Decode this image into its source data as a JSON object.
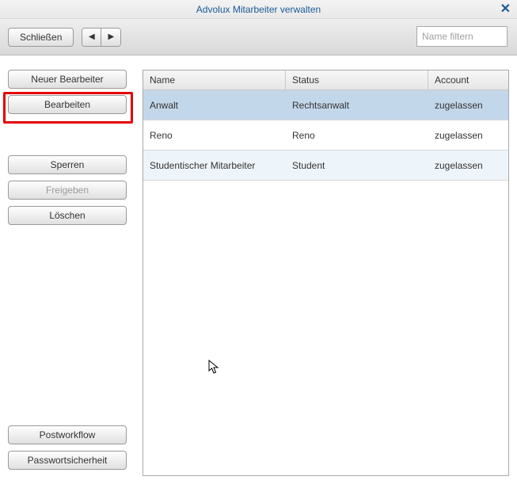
{
  "window": {
    "title": "Advolux Mitarbeiter verwalten"
  },
  "toolbar": {
    "close_label": "Schließen",
    "filter_placeholder": "Name filtern"
  },
  "sidebar": {
    "new_label": "Neuer Bearbeiter",
    "edit_label": "Bearbeiten",
    "lock_label": "Sperren",
    "unlock_label": "Freigeben",
    "delete_label": "Löschen",
    "postworkflow_label": "Postworkflow",
    "password_label": "Passwortsicherheit"
  },
  "table": {
    "headers": {
      "name": "Name",
      "status": "Status",
      "account": "Account"
    },
    "rows": [
      {
        "name": "Anwalt",
        "status": "Rechtsanwalt",
        "account": "zugelassen"
      },
      {
        "name": "Reno",
        "status": "Reno",
        "account": "zugelassen"
      },
      {
        "name": "Studentischer Mitarbeiter",
        "status": "Student",
        "account": "zugelassen"
      }
    ]
  }
}
